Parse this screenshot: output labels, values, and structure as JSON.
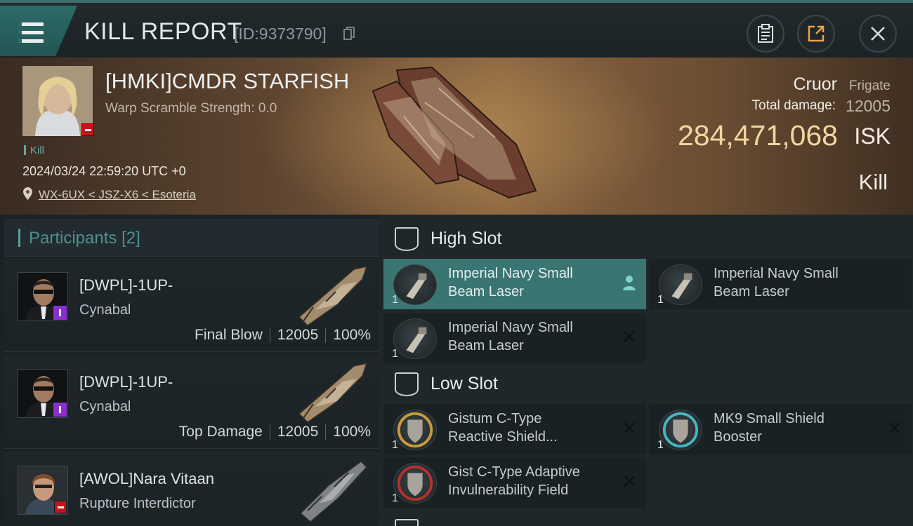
{
  "header": {
    "title": "KILL REPORT",
    "report_id": "[ID:9373790]",
    "icons": [
      "menu-icon",
      "copy-icon",
      "clipboard-icon",
      "share-icon",
      "close-icon"
    ]
  },
  "victim": {
    "name": "[HMKI]CMDR STARFISH",
    "warp_scramble": "Warp Scramble Strength: 0.0",
    "kill_tag": "Kill",
    "datetime": "2024/03/24 22:59:20 UTC +0",
    "location": "WX-6UX < JSZ-X6 < Esoteria",
    "ship_name": "Cruor",
    "ship_class": "Frigate",
    "total_damage_label": "Total damage:",
    "total_damage_value": "12005",
    "isk_value": "284,471,068",
    "isk_unit": "ISK",
    "result": "Kill"
  },
  "participants": {
    "title": "Participants",
    "count": "[2]",
    "rows": [
      {
        "name": "[DWPL]-1UP-",
        "ship": "Cynabal",
        "role": "Final Blow",
        "damage": "12005",
        "percent": "100%"
      },
      {
        "name": "[DWPL]-1UP-",
        "ship": "Cynabal",
        "role": "Top Damage",
        "damage": "12005",
        "percent": "100%"
      },
      {
        "name": "[AWOL]Nara Vitaan",
        "ship": "Rupture Interdictor"
      }
    ]
  },
  "slots": {
    "high_slot_label": "High Slot",
    "low_slot_label": "Low Slot",
    "high_modules": [
      {
        "line1": "Imperial Navy Small",
        "line2": "Beam Laser",
        "count": "1"
      },
      {
        "line1": "Imperial Navy Small",
        "line2": "Beam Laser",
        "count": "1"
      },
      {
        "line1": "Imperial Navy Small",
        "line2": "Beam Laser",
        "count": "1"
      }
    ],
    "low_modules": [
      {
        "line1": "Gistum C-Type",
        "line2": "Reactive Shield...",
        "count": "1"
      },
      {
        "line1": "MK9 Small Shield",
        "line2": "Booster",
        "count": "1"
      },
      {
        "line1": "Gist C-Type Adaptive",
        "line2": "Invulnerability Field",
        "count": "1"
      }
    ]
  },
  "colors": {
    "accent_teal": "#3a7572",
    "isk_gold": "#f2d6a0",
    "badge_red": "#c3161c",
    "badge_purple": "#8a2fd1"
  }
}
